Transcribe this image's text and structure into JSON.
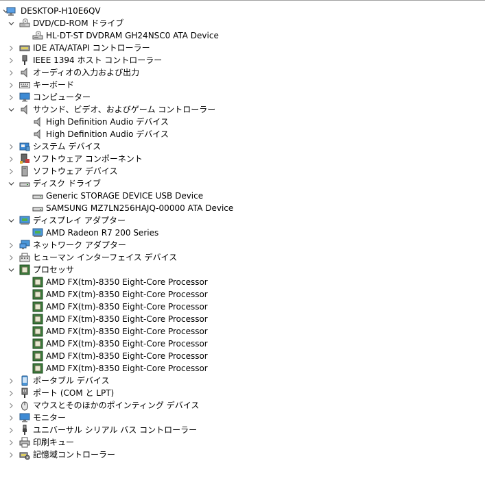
{
  "tree": [
    {
      "label": "DESKTOP-H10E6QV",
      "level": 0,
      "expander": "expanded",
      "icon": "computer-root-icon"
    },
    {
      "label": "DVD/CD-ROM ドライブ",
      "level": 1,
      "expander": "expanded",
      "icon": "dvd-drive-icon"
    },
    {
      "label": "HL-DT-ST DVDRAM GH24NSC0 ATA Device",
      "level": 2,
      "expander": "none",
      "icon": "dvd-drive-icon"
    },
    {
      "label": "IDE ATA/ATAPI コントローラー",
      "level": 1,
      "expander": "collapsed",
      "icon": "ide-controller-icon"
    },
    {
      "label": "IEEE 1394 ホスト コントローラー",
      "level": 1,
      "expander": "collapsed",
      "icon": "ieee1394-icon"
    },
    {
      "label": "オーディオの入力および出力",
      "level": 1,
      "expander": "collapsed",
      "icon": "speaker-icon"
    },
    {
      "label": "キーボード",
      "level": 1,
      "expander": "collapsed",
      "icon": "keyboard-icon"
    },
    {
      "label": "コンピューター",
      "level": 1,
      "expander": "collapsed",
      "icon": "monitor-icon"
    },
    {
      "label": "サウンド、ビデオ、およびゲーム コントローラー",
      "level": 1,
      "expander": "expanded",
      "icon": "speaker-icon"
    },
    {
      "label": "High Definition Audio デバイス",
      "level": 2,
      "expander": "none",
      "icon": "speaker-icon"
    },
    {
      "label": "High Definition Audio デバイス",
      "level": 2,
      "expander": "none",
      "icon": "speaker-icon"
    },
    {
      "label": "システム デバイス",
      "level": 1,
      "expander": "collapsed",
      "icon": "system-devices-icon"
    },
    {
      "label": "ソフトウェア コンポーネント",
      "level": 1,
      "expander": "collapsed",
      "icon": "software-component-icon"
    },
    {
      "label": "ソフトウェア デバイス",
      "level": 1,
      "expander": "collapsed",
      "icon": "software-device-icon"
    },
    {
      "label": "ディスク ドライブ",
      "level": 1,
      "expander": "expanded",
      "icon": "disk-drive-icon"
    },
    {
      "label": "Generic STORAGE DEVICE USB Device",
      "level": 2,
      "expander": "none",
      "icon": "disk-drive-icon"
    },
    {
      "label": "SAMSUNG MZ7LN256HAJQ-00000 ATA Device",
      "level": 2,
      "expander": "none",
      "icon": "disk-drive-icon"
    },
    {
      "label": "ディスプレイ アダプター",
      "level": 1,
      "expander": "expanded",
      "icon": "display-adapter-icon"
    },
    {
      "label": "AMD Radeon R7 200 Series",
      "level": 2,
      "expander": "none",
      "icon": "display-adapter-icon"
    },
    {
      "label": "ネットワーク アダプター",
      "level": 1,
      "expander": "collapsed",
      "icon": "network-adapter-icon"
    },
    {
      "label": "ヒューマン インターフェイス デバイス",
      "level": 1,
      "expander": "collapsed",
      "icon": "hid-icon"
    },
    {
      "label": "プロセッサ",
      "level": 1,
      "expander": "expanded",
      "icon": "processor-icon"
    },
    {
      "label": "AMD FX(tm)-8350 Eight-Core Processor",
      "level": 2,
      "expander": "none",
      "icon": "processor-icon"
    },
    {
      "label": "AMD FX(tm)-8350 Eight-Core Processor",
      "level": 2,
      "expander": "none",
      "icon": "processor-icon"
    },
    {
      "label": "AMD FX(tm)-8350 Eight-Core Processor",
      "level": 2,
      "expander": "none",
      "icon": "processor-icon"
    },
    {
      "label": "AMD FX(tm)-8350 Eight-Core Processor",
      "level": 2,
      "expander": "none",
      "icon": "processor-icon"
    },
    {
      "label": "AMD FX(tm)-8350 Eight-Core Processor",
      "level": 2,
      "expander": "none",
      "icon": "processor-icon"
    },
    {
      "label": "AMD FX(tm)-8350 Eight-Core Processor",
      "level": 2,
      "expander": "none",
      "icon": "processor-icon"
    },
    {
      "label": "AMD FX(tm)-8350 Eight-Core Processor",
      "level": 2,
      "expander": "none",
      "icon": "processor-icon"
    },
    {
      "label": "AMD FX(tm)-8350 Eight-Core Processor",
      "level": 2,
      "expander": "none",
      "icon": "processor-icon"
    },
    {
      "label": "ポータブル デバイス",
      "level": 1,
      "expander": "collapsed",
      "icon": "portable-device-icon"
    },
    {
      "label": "ポート (COM と LPT)",
      "level": 1,
      "expander": "collapsed",
      "icon": "port-icon"
    },
    {
      "label": "マウスとそのほかのポインティング デバイス",
      "level": 1,
      "expander": "collapsed",
      "icon": "mouse-icon"
    },
    {
      "label": "モニター",
      "level": 1,
      "expander": "collapsed",
      "icon": "monitor-icon"
    },
    {
      "label": "ユニバーサル シリアル バス コントローラー",
      "level": 1,
      "expander": "collapsed",
      "icon": "usb-icon"
    },
    {
      "label": "印刷キュー",
      "level": 1,
      "expander": "collapsed",
      "icon": "printer-icon"
    },
    {
      "label": "記憶域コントローラー",
      "level": 1,
      "expander": "collapsed",
      "icon": "storage-controller-icon"
    }
  ]
}
